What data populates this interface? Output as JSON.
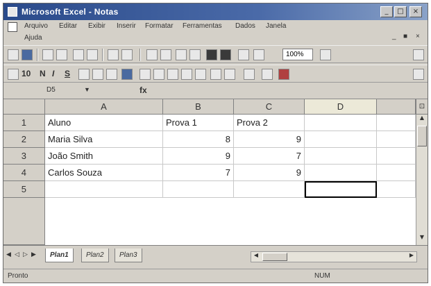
{
  "window": {
    "title": "Microsoft Excel - Notas",
    "minimize_glyph": "_",
    "maximize_glyph": "□",
    "close_glyph": "×"
  },
  "menu": {
    "items": [
      "Arquivo",
      "Editar",
      "Exibir",
      "Inserir",
      "Formatar",
      "Ferramentas",
      "Dados",
      "Janela"
    ],
    "second_row_item": "Ajuda",
    "ctrl_glyphs": [
      "_",
      "■",
      "×"
    ]
  },
  "toolbar": {
    "zoom": "100%",
    "font_size": "10",
    "bold": "N",
    "italic": "I",
    "underline": "S"
  },
  "formula_bar": {
    "name_box": "D5",
    "fx": "fx",
    "value": ""
  },
  "sheet": {
    "columns": [
      "A",
      "B",
      "C",
      "D"
    ],
    "rows": [
      {
        "num": "1",
        "cells": [
          "Aluno",
          "Prova 1",
          "Prova 2",
          ""
        ]
      },
      {
        "num": "2",
        "cells": [
          "Maria Silva",
          "8",
          "9",
          ""
        ]
      },
      {
        "num": "3",
        "cells": [
          "João Smith",
          "9",
          "7",
          ""
        ]
      },
      {
        "num": "4",
        "cells": [
          "Carlos Souza",
          "7",
          "9",
          ""
        ]
      },
      {
        "num": "5",
        "cells": [
          "",
          "",
          "",
          ""
        ]
      }
    ],
    "active_cell": "D5"
  },
  "tabs": [
    "Plan1",
    "Plan2",
    "Plan3"
  ],
  "active_tab": "Plan1",
  "status": {
    "left": "Pronto",
    "num": "NUM"
  },
  "colors": {
    "title_bar": "#2a4a8a",
    "face": "#d4d0c8",
    "grid_line": "#c8c8c8"
  }
}
